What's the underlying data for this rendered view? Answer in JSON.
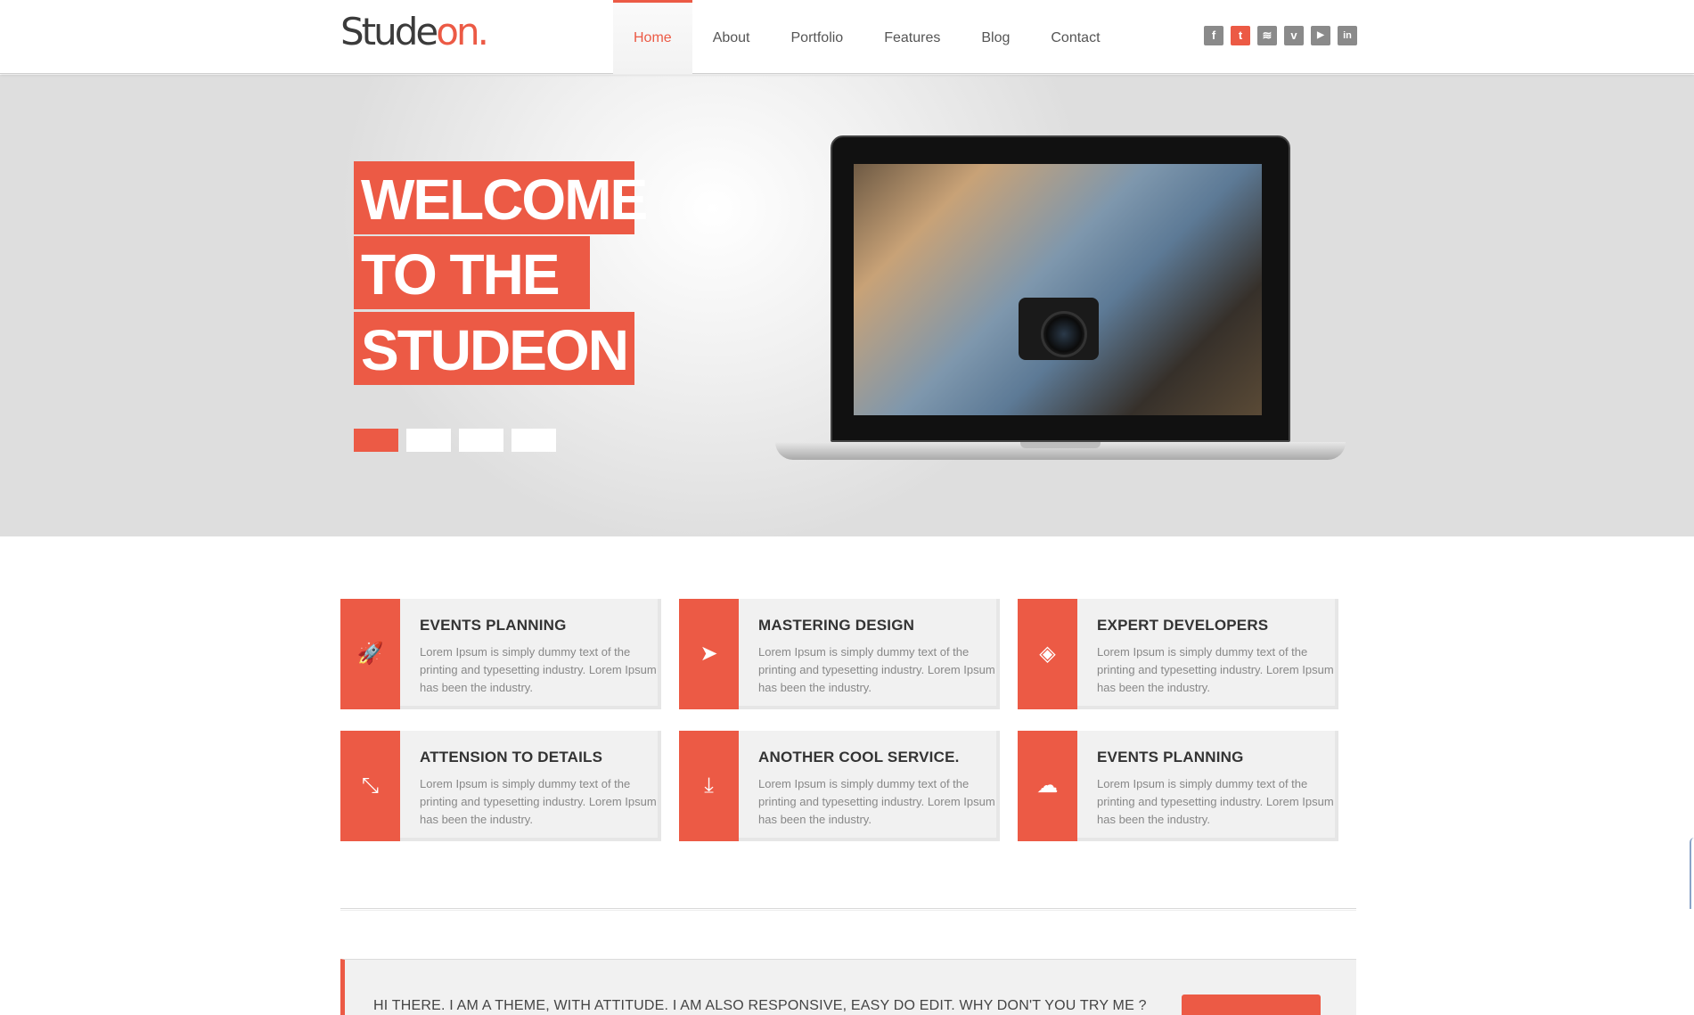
{
  "brand": {
    "logo_dark": "Stude",
    "logo_accent": "on.",
    "accent_color": "#ec5a45"
  },
  "nav": {
    "items": [
      {
        "label": "Home",
        "active": true
      },
      {
        "label": "About",
        "active": false
      },
      {
        "label": "Portfolio",
        "active": false
      },
      {
        "label": "Features",
        "active": false
      },
      {
        "label": "Blog",
        "active": false
      },
      {
        "label": "Contact",
        "active": false
      }
    ]
  },
  "social": [
    {
      "icon": "facebook-icon",
      "glyph": "f"
    },
    {
      "icon": "twitter-icon",
      "glyph": "t"
    },
    {
      "icon": "rss-icon",
      "glyph": "≋"
    },
    {
      "icon": "vimeo-icon",
      "glyph": "v"
    },
    {
      "icon": "youtube-icon",
      "glyph": "▶"
    },
    {
      "icon": "linkedin-icon",
      "glyph": "in"
    }
  ],
  "hero": {
    "lines": [
      "WELCOME",
      "TO THE",
      "STUDEON"
    ],
    "slider_dots": 4,
    "active_dot": 1
  },
  "services": [
    {
      "title": "EVENTS PLANNING",
      "text": "Lorem Ipsum is simply dummy text of the printing and typesetting industry. Lorem Ipsum has been the industry.",
      "icon": "rocket-icon"
    },
    {
      "title": "MASTERING DESIGN",
      "text": "Lorem Ipsum is simply dummy text of the printing and typesetting industry. Lorem Ipsum has been the industry.",
      "icon": "paper-plane-icon"
    },
    {
      "title": "EXPERT DEVELOPERS",
      "text": "Lorem Ipsum is simply dummy text of the printing and typesetting industry. Lorem Ipsum has been the industry.",
      "icon": "layers-icon"
    },
    {
      "title": "ATTENSION TO DETAILS",
      "text": "Lorem Ipsum is simply dummy text of the printing and typesetting industry. Lorem Ipsum has been the industry.",
      "icon": "shrink-arrows-icon"
    },
    {
      "title": "ANOTHER COOL SERVICE.",
      "text": "Lorem Ipsum is simply dummy text of the printing and typesetting industry. Lorem Ipsum has been the industry.",
      "icon": "download-icon"
    },
    {
      "title": "EVENTS PLANNING",
      "text": "Lorem Ipsum is simply dummy text of the printing and typesetting industry. Lorem Ipsum has been the industry.",
      "icon": "cloud-icon"
    }
  ],
  "cta": {
    "text": "HI THERE. I AM A THEME, WITH ATTITUDE. I AM ALSO RESPONSIVE, EASY DO EDIT. WHY DON'T YOU TRY ME ?"
  }
}
